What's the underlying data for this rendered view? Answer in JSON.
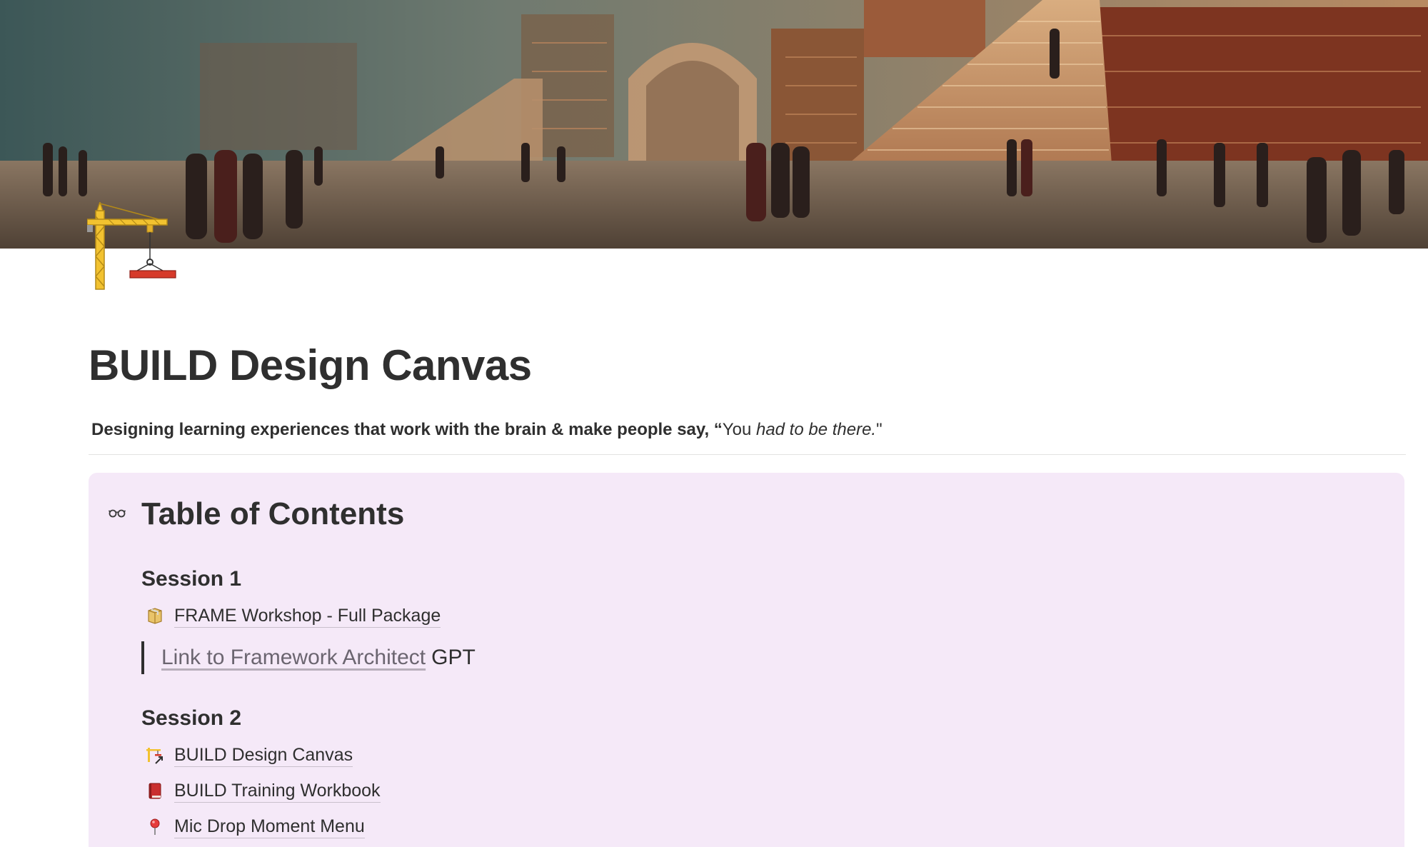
{
  "page": {
    "title": "BUILD Design Canvas",
    "icon": "tower-crane-icon",
    "cover": "library-banner-image"
  },
  "subtitle": {
    "bold_part": "Designing learning experiences that work with the brain & make people say, “",
    "plain_part": "You ",
    "italic_part": "had to be there.",
    "end_part": "\""
  },
  "toc": {
    "icon": "goggles-icon",
    "heading": "Table of Contents",
    "sessions": [
      {
        "heading": "Session 1",
        "items": [
          {
            "icon": "package-icon",
            "label": "FRAME Workshop - Full Package"
          }
        ],
        "quote": {
          "link_text": "Link to Framework Architect",
          "text": "GPT"
        }
      },
      {
        "heading": "Session 2",
        "items": [
          {
            "icon": "tower-crane-link-icon",
            "label": "BUILD Design Canvas"
          },
          {
            "icon": "red-book-icon",
            "label": "BUILD Training Workbook"
          },
          {
            "icon": "round-pushpin-icon",
            "label": "Mic Drop Moment Menu"
          }
        ]
      }
    ]
  },
  "colors": {
    "callout_bg": "#f5e9f8",
    "text": "#2f2f2f",
    "link_muted": "#6b6570",
    "divider": "#e3e3e1"
  }
}
